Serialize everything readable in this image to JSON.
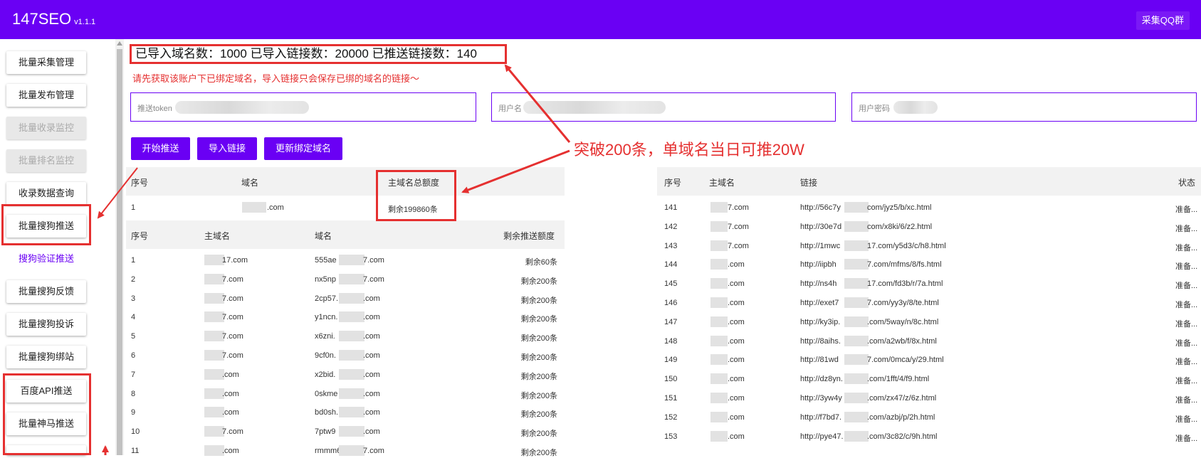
{
  "header": {
    "title": "147SEO",
    "version": "v1.1.1",
    "qq_button": "采集QQ群"
  },
  "sidebar": {
    "items": [
      {
        "label": "批量采集管理",
        "state": "normal"
      },
      {
        "label": "批量发布管理",
        "state": "normal"
      },
      {
        "label": "批量收录监控",
        "state": "disabled"
      },
      {
        "label": "批量排名监控",
        "state": "disabled"
      },
      {
        "label": "收录数据查询",
        "state": "normal"
      },
      {
        "label": "批量搜狗推送",
        "state": "normal"
      },
      {
        "label": "搜狗验证推送",
        "state": "active"
      },
      {
        "label": "批量搜狗反馈",
        "state": "normal"
      },
      {
        "label": "批量搜狗投诉",
        "state": "normal"
      },
      {
        "label": "批量搜狗绑站",
        "state": "normal"
      },
      {
        "label": "百度API推送",
        "state": "normal"
      },
      {
        "label": "批量神马推送",
        "state": "normal"
      }
    ]
  },
  "stats": {
    "text": "已导入域名数：1000 已导入链接数：20000 已推送链接数：140"
  },
  "notice": "请先获取该账户下已绑定域名，导入链接只会保存已绑的域名的链接～",
  "fields": {
    "token_label": "推送token",
    "username_label": "用户名",
    "password_label": "用户密码"
  },
  "actions": {
    "start": "开始推送",
    "import": "导入链接",
    "refresh": "更新绑定域名"
  },
  "annotation": "突破200条，单域名当日可推20W",
  "quota_table": {
    "headers": [
      "序号",
      "域名",
      "主域名总额度"
    ],
    "rows": [
      {
        "no": "1",
        "domain": ".com",
        "quota": "剩余199860条"
      }
    ]
  },
  "domain_table": {
    "headers": [
      "序号",
      "主域名",
      "域名",
      "剩余推送额度"
    ],
    "rows": [
      {
        "no": "1",
        "main": "17.com",
        "domain_a": "555ae",
        "domain_b": "7.com",
        "remain": "剩余60条"
      },
      {
        "no": "2",
        "main": "7.com",
        "domain_a": "nx5np",
        "domain_b": "7.com",
        "remain": "剩余200条"
      },
      {
        "no": "3",
        "main": "7.com",
        "domain_a": "2cp57.",
        "domain_b": ".com",
        "remain": "剩余200条"
      },
      {
        "no": "4",
        "main": "7.com",
        "domain_a": "y1ncn.",
        "domain_b": ".com",
        "remain": "剩余200条"
      },
      {
        "no": "5",
        "main": "7.com",
        "domain_a": "x6zni.",
        "domain_b": ".com",
        "remain": "剩余200条"
      },
      {
        "no": "6",
        "main": "7.com",
        "domain_a": "9cf0n.",
        "domain_b": ".com",
        "remain": "剩余200条"
      },
      {
        "no": "7",
        "main": ".com",
        "domain_a": "x2bid.",
        "domain_b": ".com",
        "remain": "剩余200条"
      },
      {
        "no": "8",
        "main": ".com",
        "domain_a": "0skme",
        "domain_b": ".com",
        "remain": "剩余200条"
      },
      {
        "no": "9",
        "main": ".com",
        "domain_a": "bd0sh.",
        "domain_b": ".com",
        "remain": "剩余200条"
      },
      {
        "no": "10",
        "main": "7.com",
        "domain_a": "7ptw9",
        "domain_b": ".com",
        "remain": "剩余200条"
      },
      {
        "no": "11",
        "main": ".com",
        "domain_a": "rmmm6",
        "domain_b": "7.com",
        "remain": "剩余200条"
      }
    ]
  },
  "link_table": {
    "headers": [
      "序号",
      "主域名",
      "链接",
      "状态"
    ],
    "rows": [
      {
        "no": "141",
        "main": "7.com",
        "url_a": "http://56c7y",
        "url_b": "com/jyz5/b/xc.html",
        "status": "准备..."
      },
      {
        "no": "142",
        "main": "7.com",
        "url_a": "http://30e7d",
        "url_b": "com/x8ki/6/z2.html",
        "status": "准备..."
      },
      {
        "no": "143",
        "main": "7.com",
        "url_a": "http://1mwc",
        "url_b": "17.com/y5d3/c/h8.html",
        "status": "准备..."
      },
      {
        "no": "144",
        "main": ".com",
        "url_a": "http://iipbh",
        "url_b": "7.com/mfms/8/fs.html",
        "status": "准备..."
      },
      {
        "no": "145",
        "main": ".com",
        "url_a": "http://ns4h",
        "url_b": "17.com/fd3b/r/7a.html",
        "status": "准备..."
      },
      {
        "no": "146",
        "main": ".com",
        "url_a": "http://exet7",
        "url_b": "7.com/yy3y/8/te.html",
        "status": "准备..."
      },
      {
        "no": "147",
        "main": ".com",
        "url_a": "http://ky3ip.",
        "url_b": ".com/5way/n/8c.html",
        "status": "准备..."
      },
      {
        "no": "148",
        "main": ".com",
        "url_a": "http://8aihs.",
        "url_b": ".com/a2wb/f/8x.html",
        "status": "准备..."
      },
      {
        "no": "149",
        "main": ".com",
        "url_a": "http://81wd",
        "url_b": "7.com/0mca/y/29.html",
        "status": "准备..."
      },
      {
        "no": "150",
        "main": ".com",
        "url_a": "http://dz8yn.",
        "url_b": ".com/1fft/4/f9.html",
        "status": "准备..."
      },
      {
        "no": "151",
        "main": ".com",
        "url_a": "http://3yw4y",
        "url_b": ".com/zx47/z/6z.html",
        "status": "准备..."
      },
      {
        "no": "152",
        "main": ".com",
        "url_a": "http://f7bd7.",
        "url_b": ".com/azbj/p/2h.html",
        "status": "准备..."
      },
      {
        "no": "153",
        "main": ".com",
        "url_a": "http://pye47.",
        "url_b": ".com/3c82/c/9h.html",
        "status": "准备..."
      }
    ]
  },
  "colors": {
    "brand": "#6a00f4",
    "annotation": "#e53030"
  }
}
